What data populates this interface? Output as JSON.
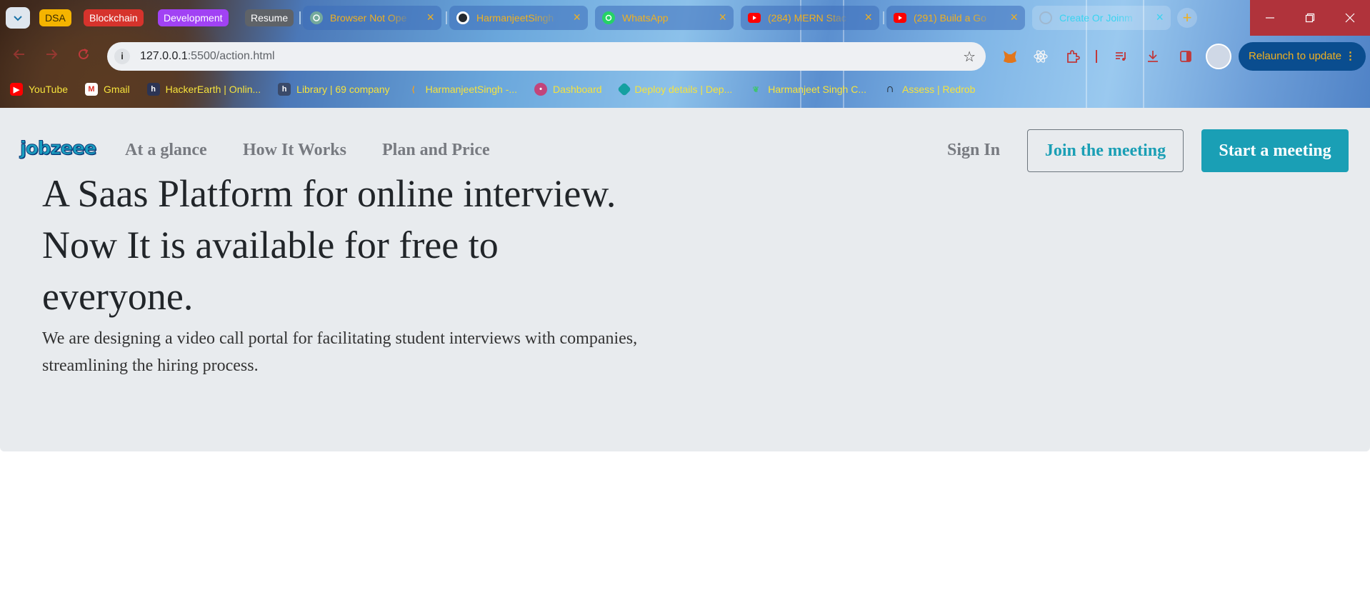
{
  "browser": {
    "tab_groups": [
      "DSA",
      "Blockchain",
      "Development",
      "Resume"
    ],
    "tabs": [
      {
        "title": "Browser Not Ope",
        "icon": "chatgpt-icon"
      },
      {
        "title": "HarmanjeetSingh",
        "icon": "github-icon"
      },
      {
        "title": "WhatsApp",
        "icon": "whatsapp-icon"
      },
      {
        "title": "(284) MERN Stac",
        "icon": "youtube-icon"
      },
      {
        "title": "(291) Build a Go",
        "icon": "youtube-icon"
      },
      {
        "title": "Create Or Joinm",
        "icon": "loading-icon"
      }
    ],
    "url_host": "127.0.0.1",
    "url_path": ":5500/action.html",
    "relaunch_label": "Relaunch to update",
    "bookmarks": [
      {
        "label": "YouTube",
        "icon": "youtube-icon"
      },
      {
        "label": "Gmail",
        "icon": "gmail-icon"
      },
      {
        "label": "HackerEarth | Onlin...",
        "icon": "hackerearth-icon"
      },
      {
        "label": "Library | 69 company",
        "icon": "library-icon"
      },
      {
        "label": "HarmanjeetSingh -...",
        "icon": "leetcode-icon"
      },
      {
        "label": "Dashboard",
        "icon": "dashboard-icon"
      },
      {
        "label": "Deploy details | Dep...",
        "icon": "netlify-icon"
      },
      {
        "label": "Harmanjeet Singh C...",
        "icon": "leaf-icon"
      },
      {
        "label": "Assess | Redrob",
        "icon": "redrob-icon"
      }
    ]
  },
  "site": {
    "logo": "jobzeee",
    "nav": {
      "at_a_glance": "At a glance",
      "how_it_works": "How It Works",
      "plan_and_price": "Plan and Price",
      "sign_in": "Sign In",
      "join_meeting": "Join the meeting",
      "start_meeting": "Start a meeting"
    },
    "hero": {
      "headline": "A Saas Platform for online interview. Now It is available for free to everyone.",
      "subtext": "We are designing a video call portal for facilitating student interviews with companies, streamlining the hiring process."
    }
  }
}
